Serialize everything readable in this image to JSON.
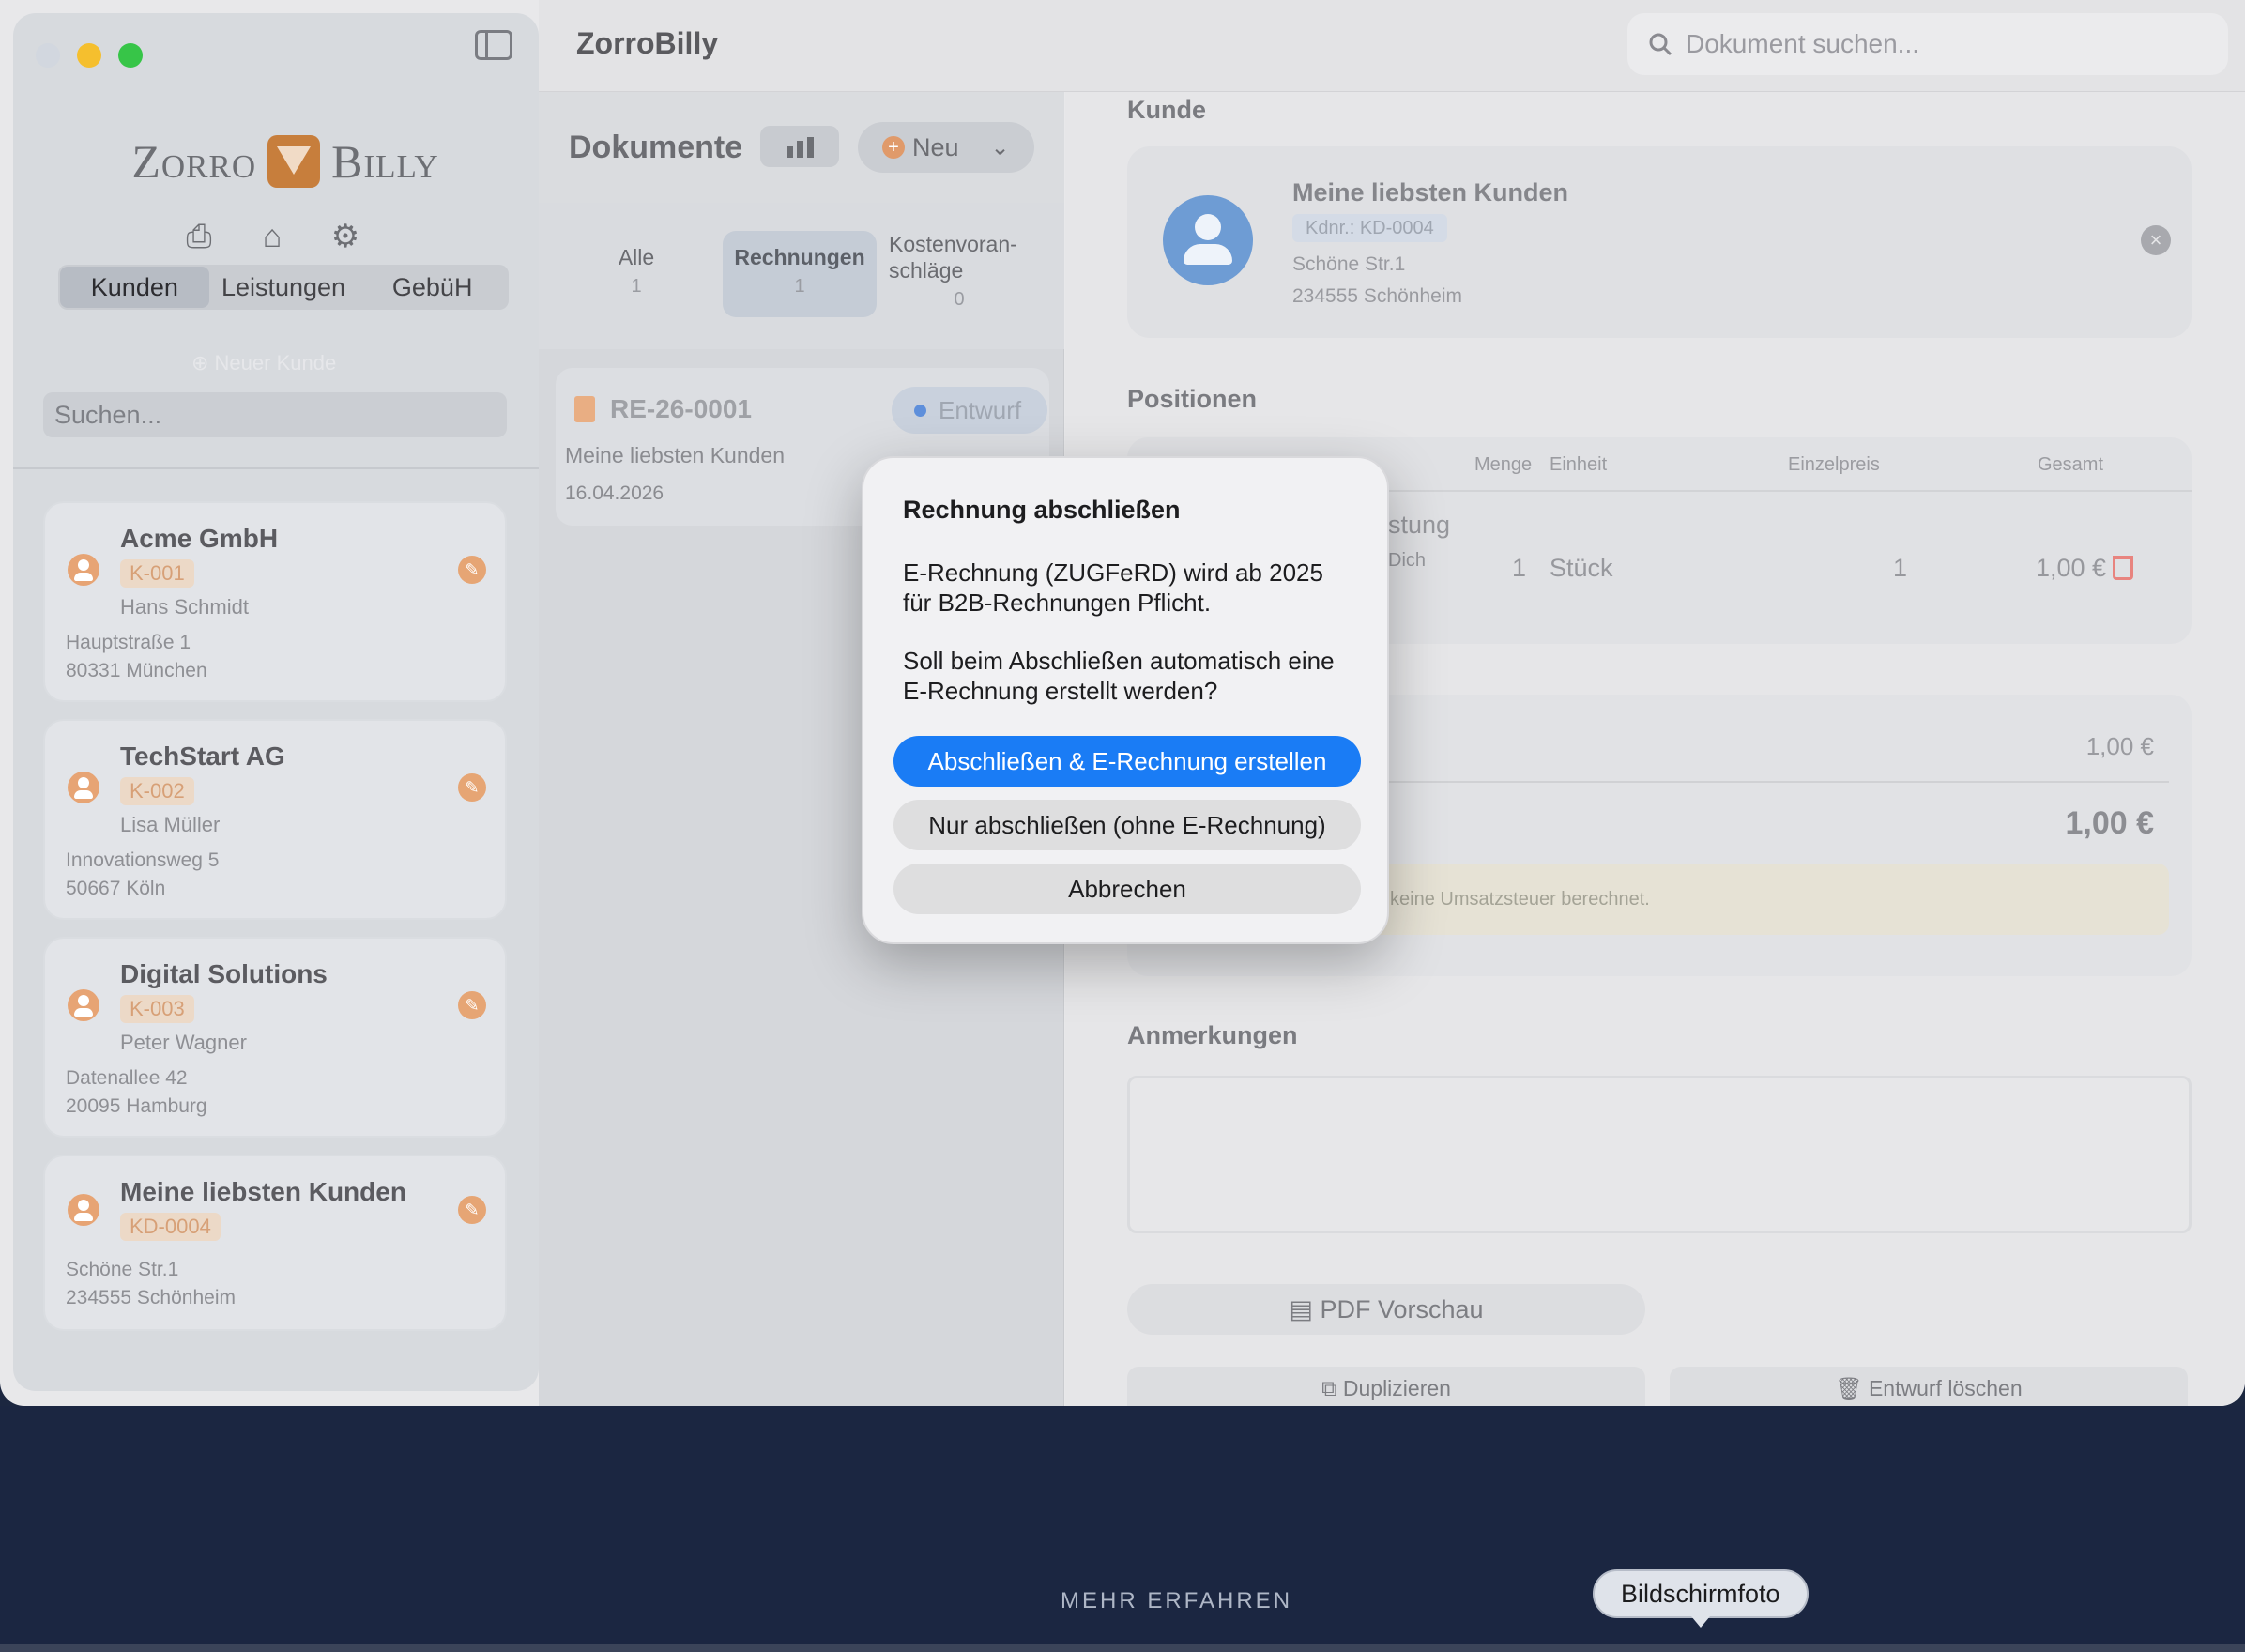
{
  "app": {
    "title": "ZorroBilly"
  },
  "search_doc": {
    "placeholder": "Dokument suchen..."
  },
  "sidebar": {
    "logo_left": "Zorro",
    "logo_right": "Billy",
    "tabs": [
      {
        "label": "Kunden",
        "active": true
      },
      {
        "label": "Leistungen",
        "active": false
      },
      {
        "label": "GebüH",
        "active": false
      }
    ],
    "new_customer": "Neuer Kunde",
    "search_placeholder": "Suchen...",
    "customers": [
      {
        "name": "Acme GmbH",
        "id": "K-001",
        "contact": "Hans Schmidt",
        "street": "Hauptstraße 1",
        "city": "80331 München"
      },
      {
        "name": "TechStart AG",
        "id": "K-002",
        "contact": "Lisa Müller",
        "street": "Innovationsweg 5",
        "city": "50667 Köln"
      },
      {
        "name": "Digital Solutions",
        "id": "K-003",
        "contact": "Peter Wagner",
        "street": "Datenallee 42",
        "city": "20095 Hamburg"
      },
      {
        "name": "Meine liebsten Kunden",
        "id": "KD-0004",
        "contact": "",
        "street": "Schöne Str.1",
        "city": "234555 Schönheim"
      }
    ]
  },
  "documents": {
    "title": "Dokumente",
    "new_label": "Neu",
    "filters": [
      {
        "label": "Alle",
        "count": "1"
      },
      {
        "label": "Rechnungen",
        "count": "1"
      },
      {
        "label": "Kostenvoran-schläge",
        "count": "0"
      }
    ],
    "items": [
      {
        "number": "RE-26-0001",
        "status": "Entwurf",
        "customer": "Meine liebsten Kunden",
        "date": "16.04.2026"
      }
    ]
  },
  "detail": {
    "customer_section": "Kunde",
    "customer": {
      "name": "Meine liebsten Kunden",
      "kdnr": "Kdnr.: KD-0004",
      "street": "Schöne Str.1",
      "city": "234555 Schönheim"
    },
    "positions_section": "Positionen",
    "columns": {
      "menge": "Menge",
      "einheit": "Einheit",
      "einzelpreis": "Einzelpreis",
      "gesamt": "Gesamt"
    },
    "position": {
      "name_partial": "stung",
      "desc_partial": "Dich",
      "qty": "1",
      "unit": "Stück",
      "price": "1",
      "total": "1,00 €"
    },
    "subtotal": "1,00 €",
    "total": "1,00 €",
    "tax_note_partial": "keine Umsatzsteuer berechnet.",
    "notes_section": "Anmerkungen",
    "pdf_label": "PDF Vorschau",
    "duplicate_label": "Duplizieren",
    "delete_label": "Entwurf löschen"
  },
  "dialog": {
    "title": "Rechnung abschließen",
    "message1": "E-Rechnung (ZUGFeRD) wird ab 2025 für B2B-Rechnungen Pflicht.",
    "message2": "Soll beim Abschließen automatisch eine E-Rechnung erstellt werden?",
    "primary": "Abschließen & E-Rechnung erstellen",
    "secondary": "Nur abschließen (ohne E-Rechnung)",
    "cancel": "Abbrechen"
  },
  "desktop": {
    "more": "MEHR ERFAHREN",
    "tooltip": "Bildschirmfoto"
  },
  "colors": {
    "accent": "#1a7cf5",
    "orange": "#e6a574",
    "danger": "#e8847f"
  }
}
